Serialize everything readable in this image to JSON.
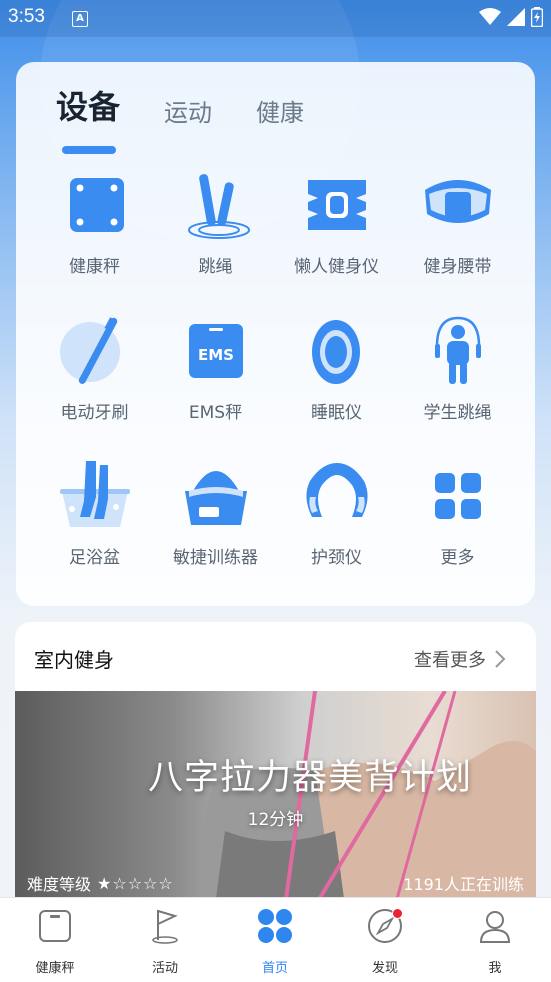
{
  "status_bar": {
    "time": "3:53",
    "notification_glyph": "A"
  },
  "tabs": [
    {
      "label": "设备",
      "active": true
    },
    {
      "label": "运动",
      "active": false
    },
    {
      "label": "健康",
      "active": false
    }
  ],
  "devices": [
    {
      "label": "健康秤",
      "icon": "scale-icon"
    },
    {
      "label": "跳绳",
      "icon": "jump-rope-icon"
    },
    {
      "label": "懒人健身仪",
      "icon": "ems-pad-icon"
    },
    {
      "label": "健身腰带",
      "icon": "waist-belt-icon"
    },
    {
      "label": "电动牙刷",
      "icon": "toothbrush-icon"
    },
    {
      "label": "EMS秤",
      "icon": "ems-scale-icon",
      "icon_text": "EMS"
    },
    {
      "label": "睡眠仪",
      "icon": "sleep-device-icon"
    },
    {
      "label": "学生跳绳",
      "icon": "student-rope-icon"
    },
    {
      "label": "足浴盆",
      "icon": "foot-bath-icon"
    },
    {
      "label": "敏捷训练器",
      "icon": "agility-trainer-icon"
    },
    {
      "label": "护颈仪",
      "icon": "neck-massager-icon"
    },
    {
      "label": "更多",
      "icon": "more-grid-icon"
    }
  ],
  "indoor_fitness": {
    "title": "室内健身",
    "more_label": "查看更多",
    "banner": {
      "title": "八字拉力器美背计划",
      "duration": "12分钟",
      "difficulty_label": "难度等级",
      "difficulty_stars": 1,
      "max_stars": 5,
      "trainees": "1191人正在训练"
    }
  },
  "bottom_nav": [
    {
      "label": "健康秤",
      "icon": "scale-nav-icon",
      "active": false
    },
    {
      "label": "活动",
      "icon": "flag-icon",
      "active": false
    },
    {
      "label": "首页",
      "icon": "home-grid-icon",
      "active": true
    },
    {
      "label": "发现",
      "icon": "compass-icon",
      "active": false,
      "badge": true
    },
    {
      "label": "我",
      "icon": "profile-icon",
      "active": false
    }
  ],
  "colors": {
    "accent": "#2f86ef",
    "icon_blue": "#3a8cf0",
    "badge_red": "#e8223b"
  }
}
